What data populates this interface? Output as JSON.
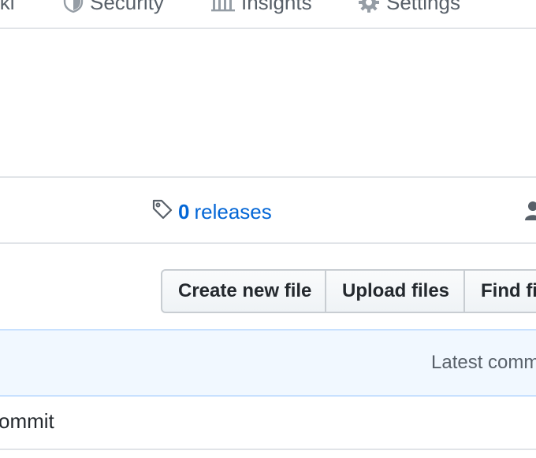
{
  "nav": {
    "items": [
      {
        "label": "iki",
        "icon": "book-icon"
      },
      {
        "label": "Security",
        "icon": "shield-icon"
      },
      {
        "label": "Insights",
        "icon": "graph-icon"
      },
      {
        "label": "Settings",
        "icon": "gear-icon"
      }
    ]
  },
  "summary": {
    "releases_count": "0",
    "releases_label": "releases"
  },
  "toolbar": {
    "create_label": "Create new file",
    "upload_label": "Upload files",
    "find_label": "Find fi"
  },
  "commit_bar": {
    "latest_label": "Latest comm"
  },
  "file_row": {
    "text": "ommit"
  },
  "colors": {
    "link": "#0366d6",
    "muted": "#586069",
    "commit_bg": "#f1f8ff",
    "border": "#e1e4e8"
  }
}
